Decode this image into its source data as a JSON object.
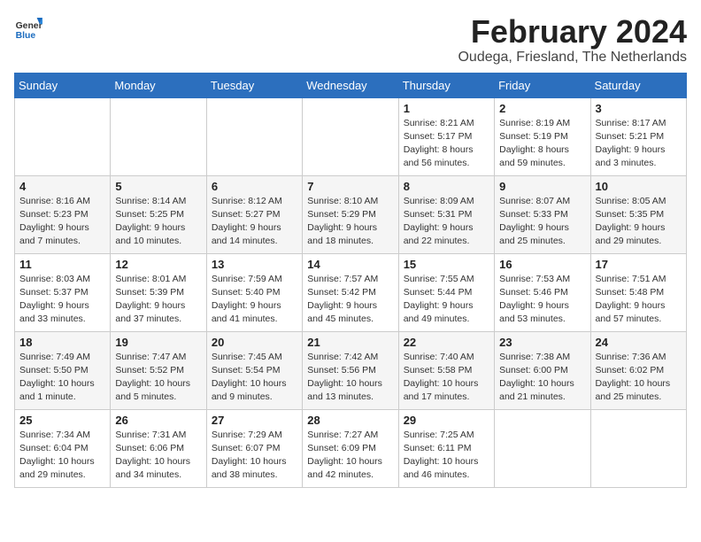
{
  "header": {
    "logo_general": "General",
    "logo_blue": "Blue",
    "title": "February 2024",
    "location": "Oudega, Friesland, The Netherlands"
  },
  "weekdays": [
    "Sunday",
    "Monday",
    "Tuesday",
    "Wednesday",
    "Thursday",
    "Friday",
    "Saturday"
  ],
  "weeks": [
    [
      {
        "day": "",
        "info": ""
      },
      {
        "day": "",
        "info": ""
      },
      {
        "day": "",
        "info": ""
      },
      {
        "day": "",
        "info": ""
      },
      {
        "day": "1",
        "info": "Sunrise: 8:21 AM\nSunset: 5:17 PM\nDaylight: 8 hours\nand 56 minutes."
      },
      {
        "day": "2",
        "info": "Sunrise: 8:19 AM\nSunset: 5:19 PM\nDaylight: 8 hours\nand 59 minutes."
      },
      {
        "day": "3",
        "info": "Sunrise: 8:17 AM\nSunset: 5:21 PM\nDaylight: 9 hours\nand 3 minutes."
      }
    ],
    [
      {
        "day": "4",
        "info": "Sunrise: 8:16 AM\nSunset: 5:23 PM\nDaylight: 9 hours\nand 7 minutes."
      },
      {
        "day": "5",
        "info": "Sunrise: 8:14 AM\nSunset: 5:25 PM\nDaylight: 9 hours\nand 10 minutes."
      },
      {
        "day": "6",
        "info": "Sunrise: 8:12 AM\nSunset: 5:27 PM\nDaylight: 9 hours\nand 14 minutes."
      },
      {
        "day": "7",
        "info": "Sunrise: 8:10 AM\nSunset: 5:29 PM\nDaylight: 9 hours\nand 18 minutes."
      },
      {
        "day": "8",
        "info": "Sunrise: 8:09 AM\nSunset: 5:31 PM\nDaylight: 9 hours\nand 22 minutes."
      },
      {
        "day": "9",
        "info": "Sunrise: 8:07 AM\nSunset: 5:33 PM\nDaylight: 9 hours\nand 25 minutes."
      },
      {
        "day": "10",
        "info": "Sunrise: 8:05 AM\nSunset: 5:35 PM\nDaylight: 9 hours\nand 29 minutes."
      }
    ],
    [
      {
        "day": "11",
        "info": "Sunrise: 8:03 AM\nSunset: 5:37 PM\nDaylight: 9 hours\nand 33 minutes."
      },
      {
        "day": "12",
        "info": "Sunrise: 8:01 AM\nSunset: 5:39 PM\nDaylight: 9 hours\nand 37 minutes."
      },
      {
        "day": "13",
        "info": "Sunrise: 7:59 AM\nSunset: 5:40 PM\nDaylight: 9 hours\nand 41 minutes."
      },
      {
        "day": "14",
        "info": "Sunrise: 7:57 AM\nSunset: 5:42 PM\nDaylight: 9 hours\nand 45 minutes."
      },
      {
        "day": "15",
        "info": "Sunrise: 7:55 AM\nSunset: 5:44 PM\nDaylight: 9 hours\nand 49 minutes."
      },
      {
        "day": "16",
        "info": "Sunrise: 7:53 AM\nSunset: 5:46 PM\nDaylight: 9 hours\nand 53 minutes."
      },
      {
        "day": "17",
        "info": "Sunrise: 7:51 AM\nSunset: 5:48 PM\nDaylight: 9 hours\nand 57 minutes."
      }
    ],
    [
      {
        "day": "18",
        "info": "Sunrise: 7:49 AM\nSunset: 5:50 PM\nDaylight: 10 hours\nand 1 minute."
      },
      {
        "day": "19",
        "info": "Sunrise: 7:47 AM\nSunset: 5:52 PM\nDaylight: 10 hours\nand 5 minutes."
      },
      {
        "day": "20",
        "info": "Sunrise: 7:45 AM\nSunset: 5:54 PM\nDaylight: 10 hours\nand 9 minutes."
      },
      {
        "day": "21",
        "info": "Sunrise: 7:42 AM\nSunset: 5:56 PM\nDaylight: 10 hours\nand 13 minutes."
      },
      {
        "day": "22",
        "info": "Sunrise: 7:40 AM\nSunset: 5:58 PM\nDaylight: 10 hours\nand 17 minutes."
      },
      {
        "day": "23",
        "info": "Sunrise: 7:38 AM\nSunset: 6:00 PM\nDaylight: 10 hours\nand 21 minutes."
      },
      {
        "day": "24",
        "info": "Sunrise: 7:36 AM\nSunset: 6:02 PM\nDaylight: 10 hours\nand 25 minutes."
      }
    ],
    [
      {
        "day": "25",
        "info": "Sunrise: 7:34 AM\nSunset: 6:04 PM\nDaylight: 10 hours\nand 29 minutes."
      },
      {
        "day": "26",
        "info": "Sunrise: 7:31 AM\nSunset: 6:06 PM\nDaylight: 10 hours\nand 34 minutes."
      },
      {
        "day": "27",
        "info": "Sunrise: 7:29 AM\nSunset: 6:07 PM\nDaylight: 10 hours\nand 38 minutes."
      },
      {
        "day": "28",
        "info": "Sunrise: 7:27 AM\nSunset: 6:09 PM\nDaylight: 10 hours\nand 42 minutes."
      },
      {
        "day": "29",
        "info": "Sunrise: 7:25 AM\nSunset: 6:11 PM\nDaylight: 10 hours\nand 46 minutes."
      },
      {
        "day": "",
        "info": ""
      },
      {
        "day": "",
        "info": ""
      }
    ]
  ]
}
